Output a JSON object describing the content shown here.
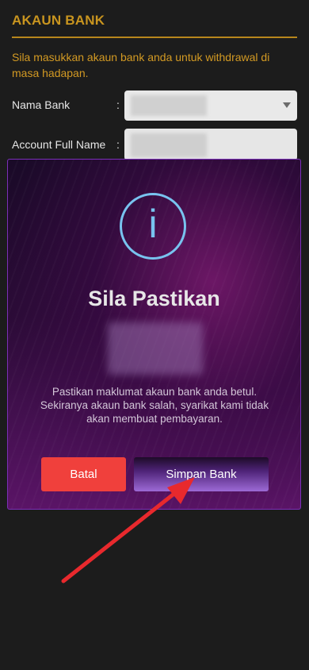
{
  "section": {
    "title": "AKAUN BANK",
    "instructions": "Sila masukkan akaun bank anda untuk withdrawal di masa hadapan."
  },
  "form": {
    "bank_label": "Nama Bank",
    "name_label": "Account Full Name",
    "colon": ":"
  },
  "modal": {
    "icon_glyph": "i",
    "title": "Sila Pastikan",
    "message": "Pastikan maklumat akaun bank anda betul. Sekiranya akaun bank salah, syarikat kami tidak akan membuat pembayaran.",
    "cancel_label": "Batal",
    "save_label": "Simpan Bank"
  },
  "colors": {
    "accent_gold": "#c9951f",
    "cancel_red": "#f0403c",
    "info_blue": "#78c3ef",
    "annotation_red": "#e8292d"
  }
}
